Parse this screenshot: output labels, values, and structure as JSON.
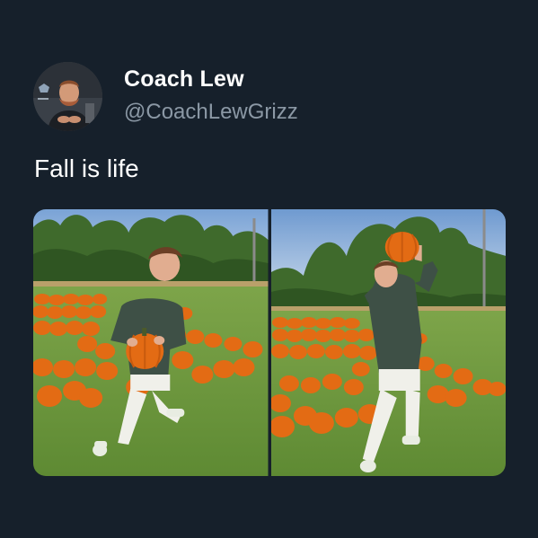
{
  "tweet": {
    "author": {
      "display_name": "Coach Lew",
      "handle": "@CoachLewGrizz",
      "avatar_icon": "profile-photo"
    },
    "text": "Fall is life",
    "media": [
      {
        "icon": "photo-pumpkin-hold"
      },
      {
        "icon": "photo-pumpkin-lift"
      }
    ]
  },
  "colors": {
    "background": "#16202b",
    "text_primary": "#ffffff",
    "text_secondary": "#8b98a5",
    "pumpkin": "#e36b14",
    "grass": "#6f9a3c"
  }
}
